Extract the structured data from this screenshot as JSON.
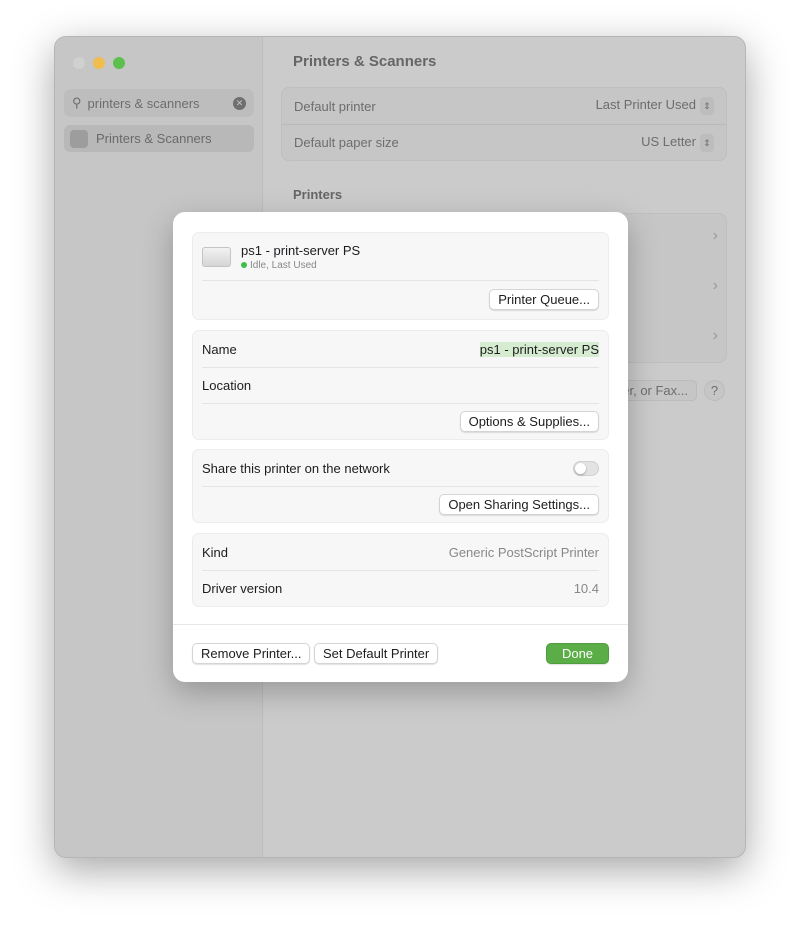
{
  "window": {
    "traffic_lights": [
      "#d0d0d0",
      "#f0bd4f",
      "#5cc04d"
    ]
  },
  "sidebar": {
    "search_value": "printers & scanners",
    "items": [
      {
        "label": "Printers & Scanners"
      }
    ]
  },
  "main": {
    "title": "Printers & Scanners",
    "defaults": [
      {
        "label": "Default printer",
        "value": "Last Printer Used"
      },
      {
        "label": "Default paper size",
        "value": "US Letter"
      }
    ],
    "printers_heading": "Printers",
    "add_button": "er, or Fax...",
    "help": "?"
  },
  "dialog": {
    "printer_name": "ps1 - print-server PS",
    "status": "Idle, Last Used",
    "status_color": "#3fbf4a",
    "printer_queue_button": "Printer Queue...",
    "name_label": "Name",
    "name_value": "ps1 - print-server PS",
    "location_label": "Location",
    "location_value": "",
    "options_button": "Options & Supplies...",
    "share_label": "Share this printer on the network",
    "share_enabled": false,
    "sharing_settings_button": "Open Sharing Settings...",
    "kind_label": "Kind",
    "kind_value": "Generic PostScript Printer",
    "driver_label": "Driver version",
    "driver_value": "10.4",
    "remove_button": "Remove Printer...",
    "set_default_button": "Set Default Printer",
    "done_button": "Done",
    "accent": "#5aad47"
  }
}
